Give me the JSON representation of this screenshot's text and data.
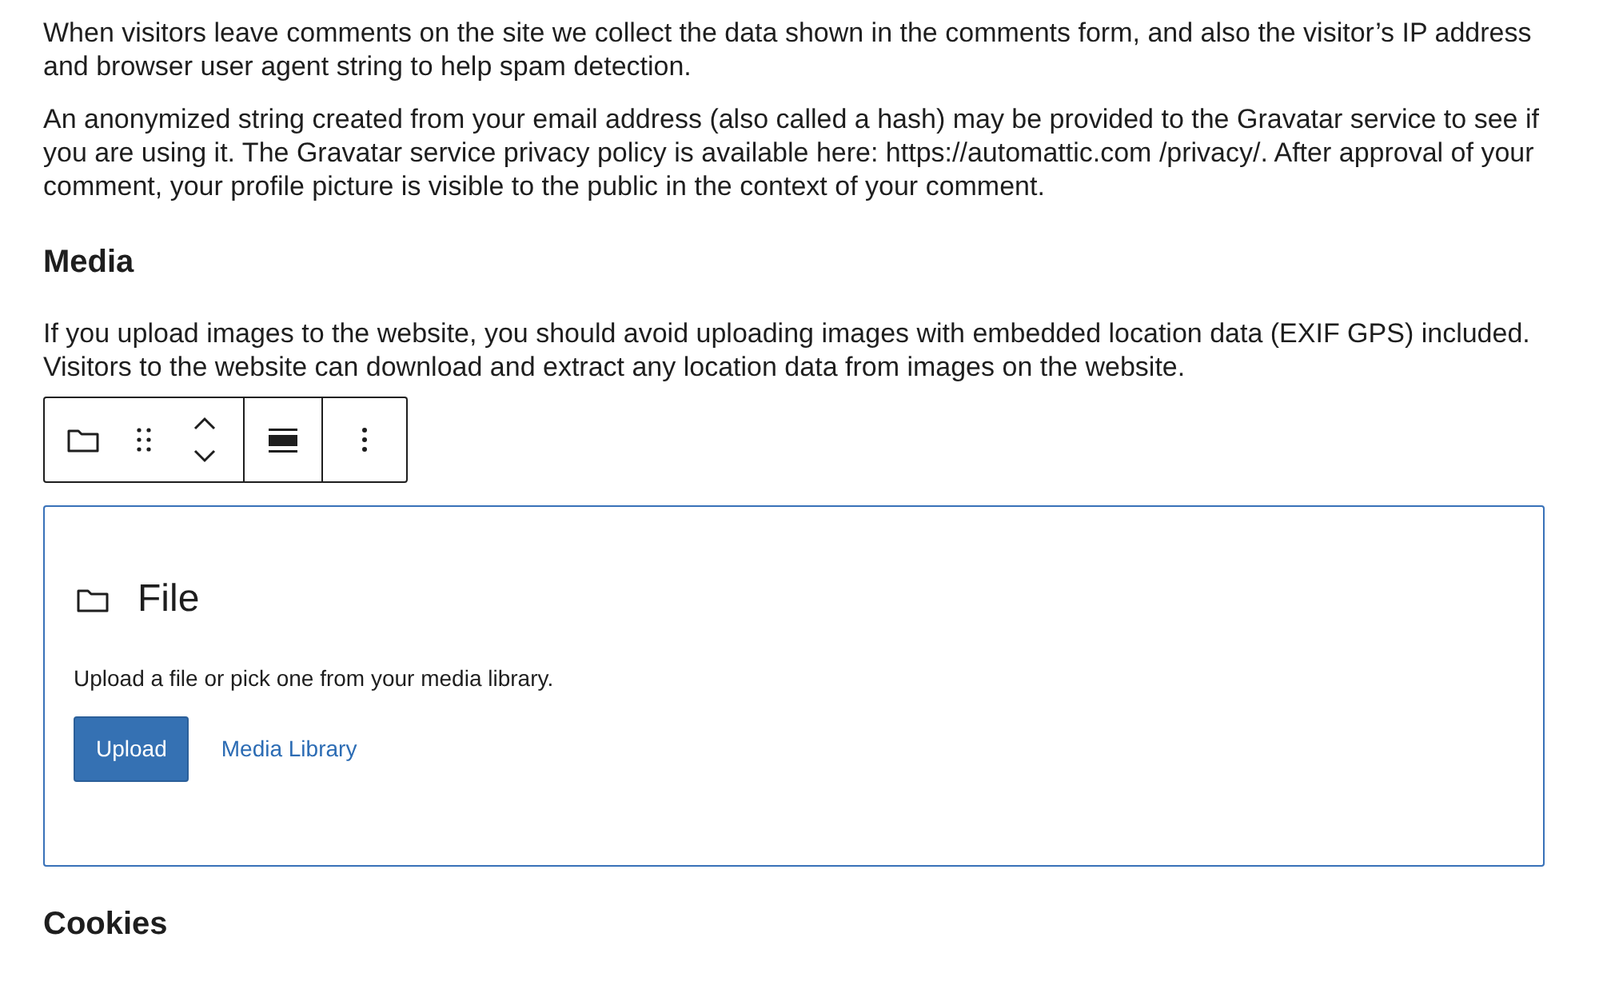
{
  "paragraphs_top": [
    "When visitors leave comments on the site we collect the data shown in the comments form, and also the visitor’s IP address and browser user agent string to help spam detection.",
    "An anonymized string created from your email address (also called a hash) may be provided to the Gravatar service to see if you are using it. The Gravatar service privacy policy is available here: https://automattic.com /privacy/. After approval of your comment, your profile picture is visible to the public in the context of your comment."
  ],
  "heading_media": "Media",
  "paragraph_media": "If you upload images to the website, you should avoid uploading images with embedded location data (EXIF GPS) included. Visitors to the website can download and extract any location data from images on the website.",
  "file_block": {
    "title": "File",
    "instructions": "Upload a file or pick one from your media library.",
    "buttons": [
      {
        "label": "Upload",
        "kind": "primary"
      },
      {
        "label": "Media Library",
        "kind": "link"
      }
    ]
  },
  "heading_cookies": "Cookies"
}
